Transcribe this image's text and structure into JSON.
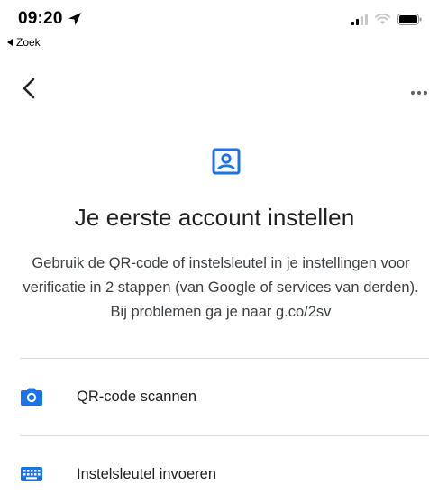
{
  "status_bar": {
    "time": "09:20",
    "back_app_label": "Zoek",
    "icons": [
      "location-arrow-icon",
      "cellular-signal-icon",
      "wifi-icon",
      "battery-icon"
    ]
  },
  "app_bar": {
    "back_icon": "chevron-left-icon",
    "menu_icon": "more-horizontal-icon"
  },
  "hero_icon": "account-box-icon",
  "title": "Je eerste account instellen",
  "description": "Gebruik de QR-code of instelsleutel in je instellingen voor verificatie in 2 stappen (van Google of services van derden). Bij problemen ga je naar g.co/2sv",
  "options": [
    {
      "label": "QR-code scannen",
      "icon": "camera-icon"
    },
    {
      "label": "Instelsleutel invoeren",
      "icon": "keyboard-icon"
    }
  ],
  "colors": {
    "accent": "#1a73e8",
    "text_primary": "#202124",
    "text_secondary": "#3c4043",
    "divider": "#dadce0"
  }
}
